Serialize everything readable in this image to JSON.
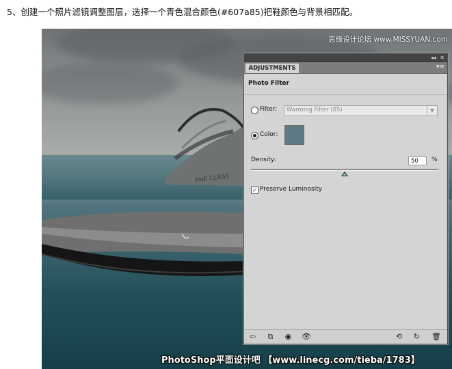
{
  "caption": "5、创建一个照片滤镜调整图层，选择一个青色混合颜色(#607a85)把鞋颜色与背景相匹配。",
  "watermark_top": "思缘设计论坛 www.MISSYUAN.com",
  "watermark_bottom": "PhotoShop平面设计吧 【www.linecg.com/tieba/1783】",
  "panel": {
    "tab_label": "ADJUSTMENTS",
    "title": "Photo Filter",
    "filter_label": "Filter:",
    "filter_value": "Warming Filter (85)",
    "filter_selected": false,
    "color_label": "Color:",
    "color_selected": true,
    "color_value": "#607a85",
    "density_label": "Density:",
    "density_value": "50",
    "density_unit": "%",
    "density_fraction": 0.5,
    "preserve_label": "Preserve Luminosity",
    "preserve_checked": true,
    "topbar_icons": [
      "collapse-icon",
      "close-icon"
    ],
    "bottom_icons": [
      "back-arrow-icon",
      "clip-to-layer-icon",
      "toggle-visibility-eye-icon",
      "view-previous-icon",
      "reset-icon",
      "delete-icon"
    ]
  }
}
